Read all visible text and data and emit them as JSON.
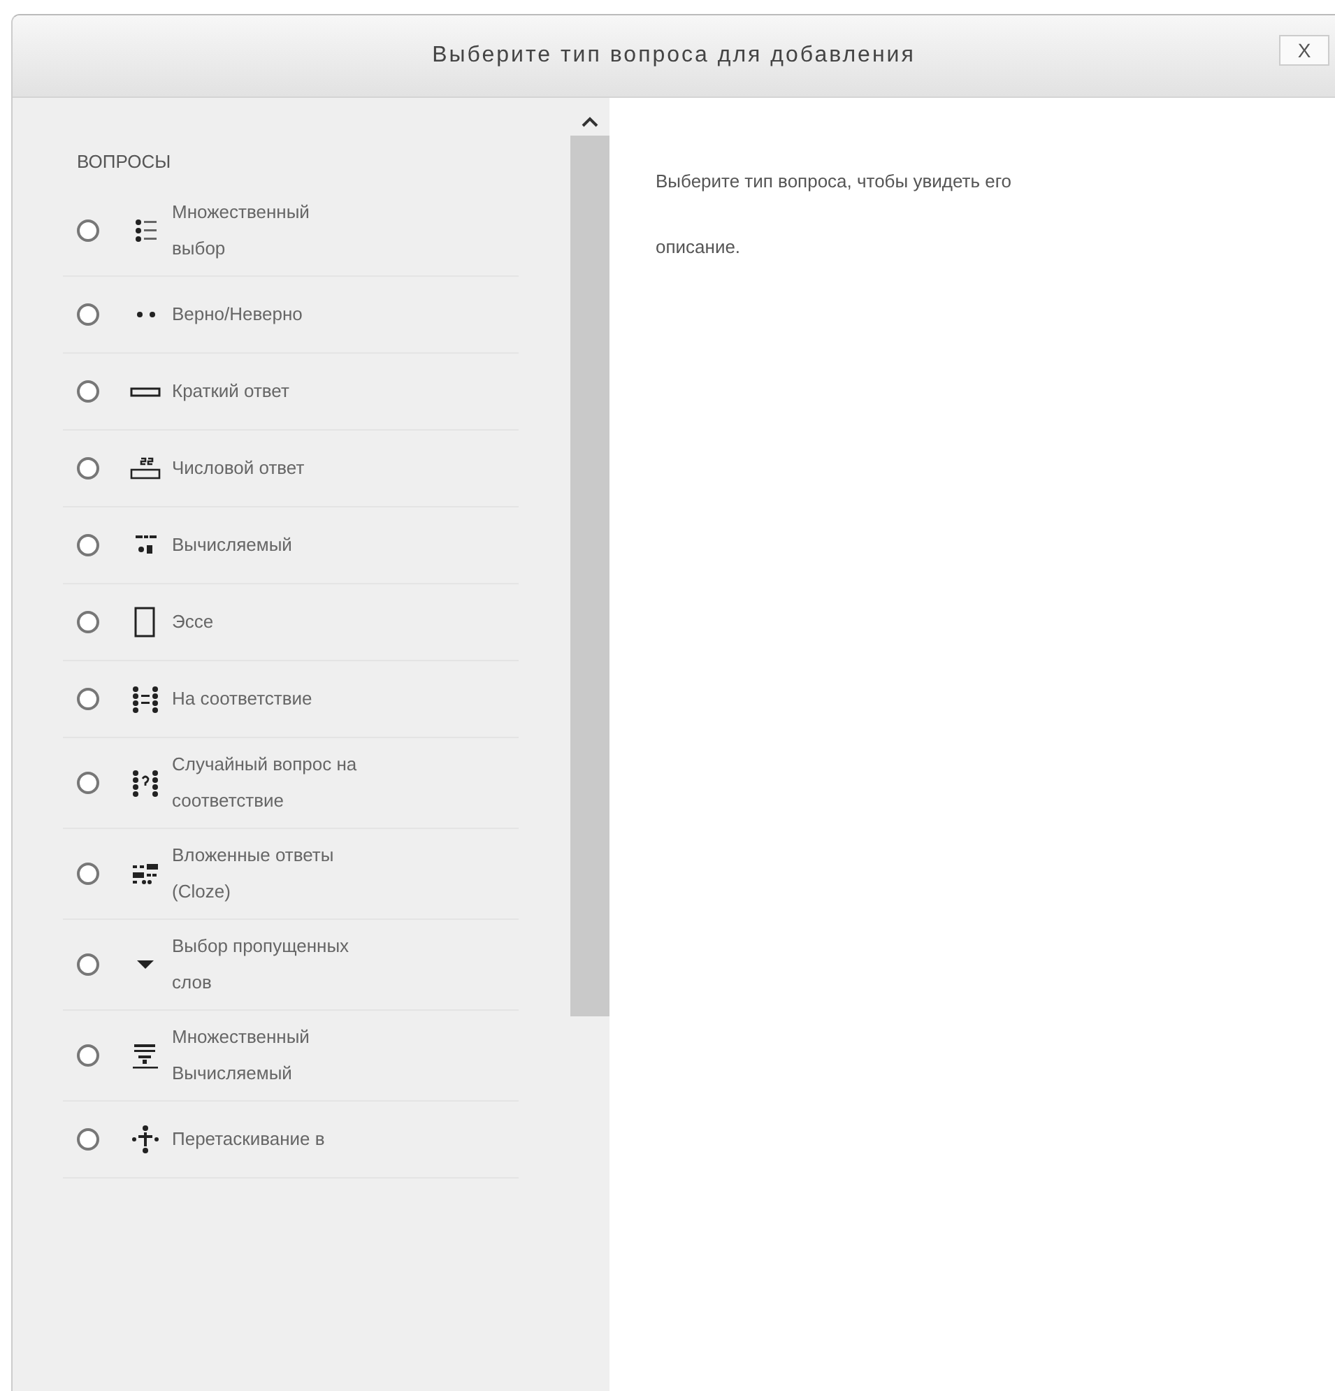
{
  "dialog": {
    "title": "Выберите тип вопроса для добавления",
    "close": "X"
  },
  "sidebar": {
    "heading": "ВОПРОСЫ",
    "items": [
      {
        "label": "Множественный выбор",
        "kind": "list",
        "selected": false
      },
      {
        "label": "Верно/Неверно",
        "kind": "dots",
        "selected": false
      },
      {
        "label": "Краткий ответ",
        "kind": "field",
        "selected": false
      },
      {
        "label": "Числовой ответ",
        "kind": "numfield",
        "selected": false
      },
      {
        "label": "Вычисляемый",
        "kind": "formula",
        "selected": false
      },
      {
        "label": "Эссе",
        "kind": "page",
        "selected": false
      },
      {
        "label": "На соответствие",
        "kind": "match",
        "selected": false
      },
      {
        "label": "Случайный вопрос на соответствие",
        "kind": "randmatch",
        "selected": false
      },
      {
        "label": "Вложенные ответы (Cloze)",
        "kind": "cloze",
        "selected": false
      },
      {
        "label": "Выбор пропущенных слов",
        "kind": "caret",
        "selected": false
      },
      {
        "label": "Множественный Вычисляемый",
        "kind": "multiformula",
        "selected": false
      },
      {
        "label": "Перетаскивание в",
        "kind": "drag",
        "selected": false
      }
    ]
  },
  "description": "Выберите тип вопроса, чтобы увидеть его описание."
}
